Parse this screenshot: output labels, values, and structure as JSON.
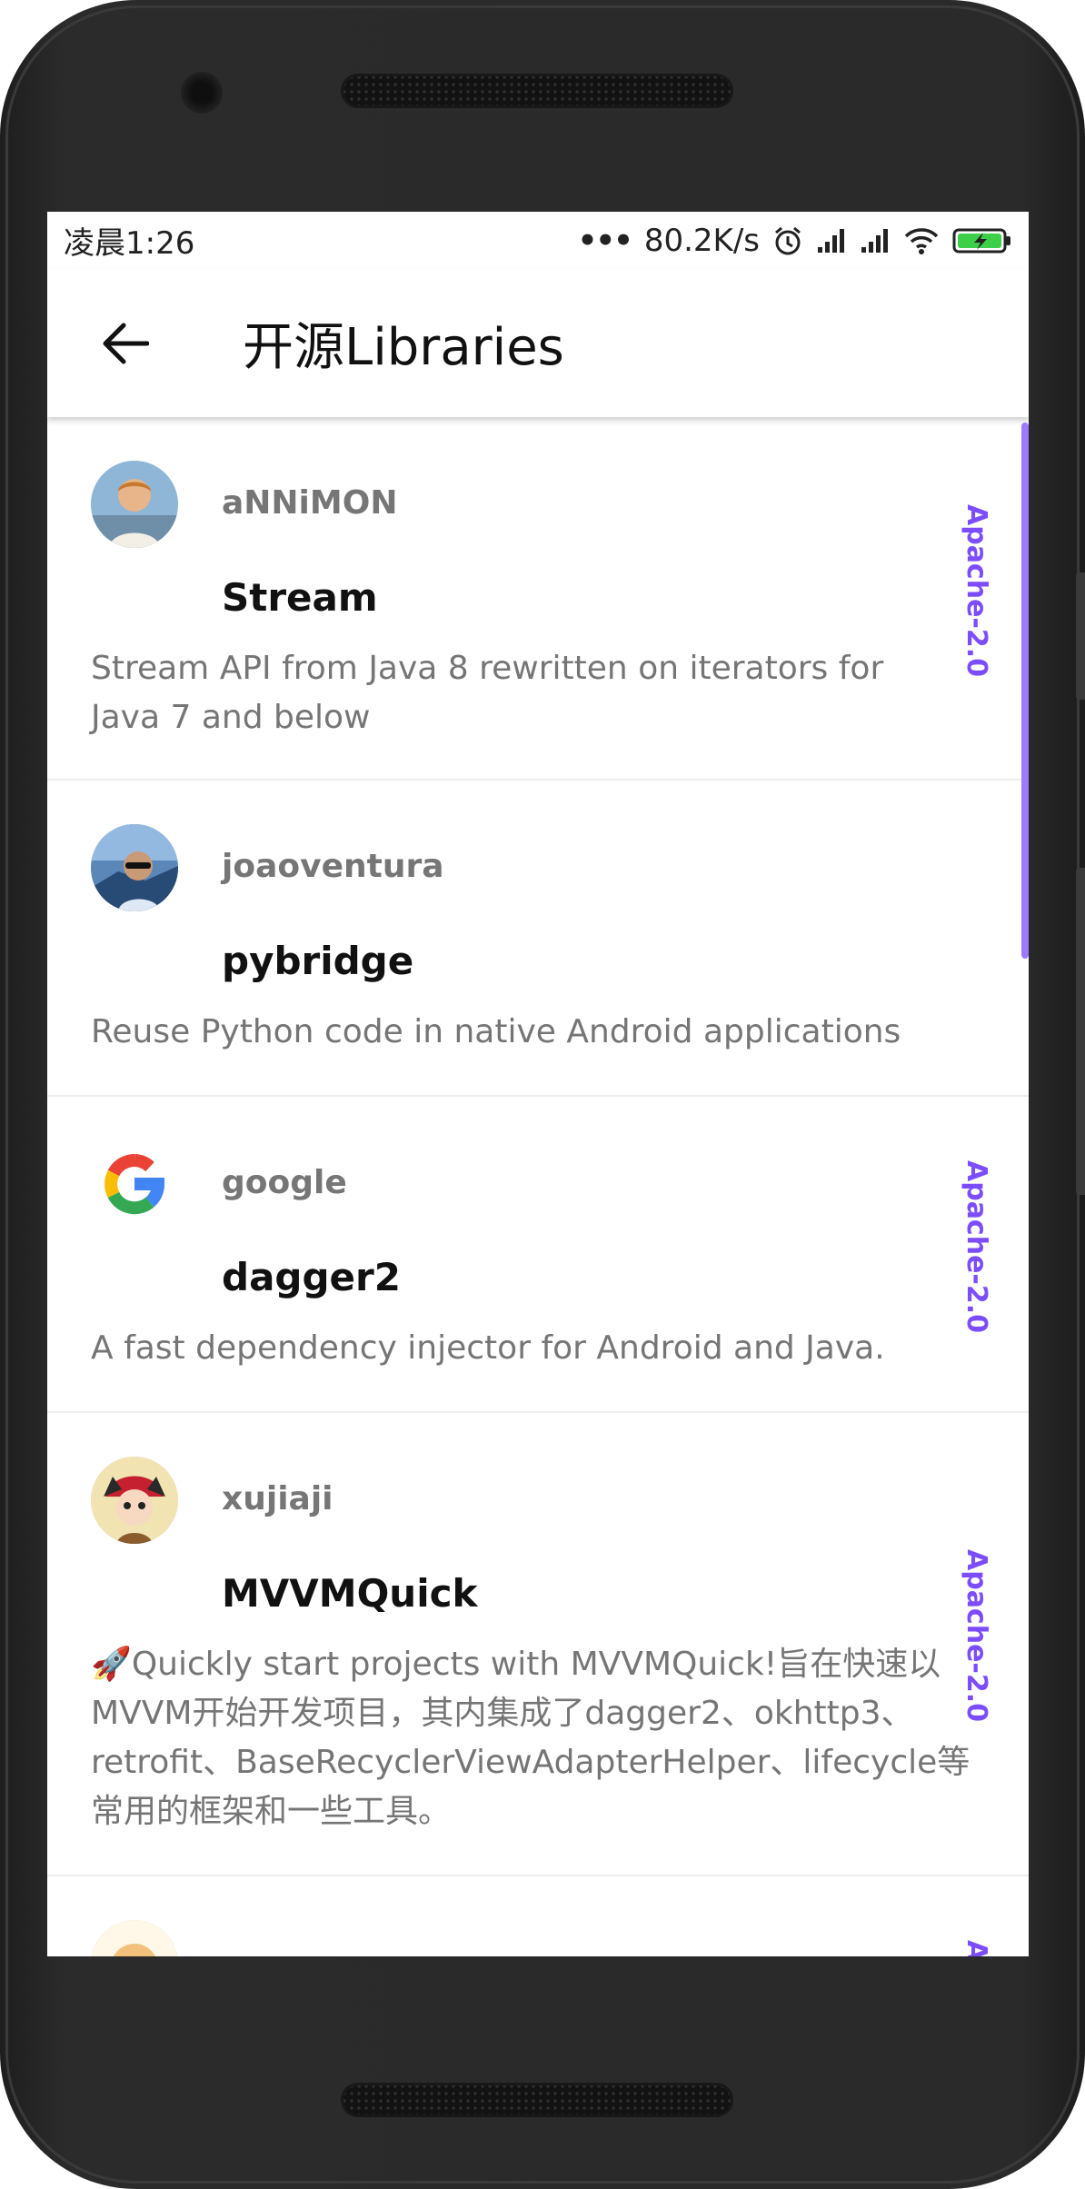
{
  "status_bar": {
    "time": "凌晨1:26",
    "dots": "•••",
    "network_speed": "80.2K/s"
  },
  "app_bar": {
    "title": "开源Libraries"
  },
  "libraries": [
    {
      "owner": "aNNiMON",
      "name": "Stream",
      "description": "Stream API from Java 8 rewritten on iterators for Java 7 and below",
      "license": "Apache-2.0"
    },
    {
      "owner": "joaoventura",
      "name": "pybridge",
      "description": "Reuse Python code in native Android applications",
      "license": ""
    },
    {
      "owner": "google",
      "name": "dagger2",
      "description": "A fast dependency injector for Android and Java.",
      "license": "Apache-2.0"
    },
    {
      "owner": "xujiaji",
      "name": "MVVMQuick",
      "description": "🚀Quickly start projects with MVVMQuick!旨在快速以MVVM开始开发项目，其内集成了dagger2、okhttp3、retrofit、BaseRecyclerViewAdapterHelper、lifecycle等常用的框架和一些工具。",
      "license": "Apache-2.0"
    }
  ],
  "colors": {
    "accent": "#7c4dff",
    "scrollbar": "#9d7bff"
  }
}
